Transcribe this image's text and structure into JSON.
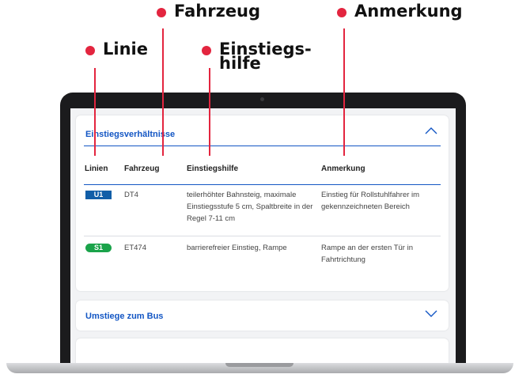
{
  "annotations": {
    "linie": "Linie",
    "fahrzeug": "Fahrzeug",
    "einstiegshilfe": "Einstiegs-\nhilfe",
    "anmerkung": "Anmerkung"
  },
  "accent_color": "#e3253f",
  "link_color": "#1356c4",
  "section_einstieg": {
    "title": "Einstiegsverhältnisse",
    "expanded": true,
    "headers": [
      "Linien",
      "Fahrzeug",
      "Einstiegshilfe",
      "Anmerkung"
    ],
    "rows": [
      {
        "line": "U1",
        "vehicle": "DT4",
        "aid": "teilerhöhter Bahnsteig, maximale Einstiegsstufe 5 cm, Spaltbreite in der Regel 7-11 cm",
        "note": "Einstieg für Rollstuhlfahrer im gekennzeichneten Bereich"
      },
      {
        "line": "S1",
        "vehicle": "ET474",
        "aid": "barrierefreier Einstieg, Rampe",
        "note": "Rampe an der ersten Tür in Fahrtrichtung"
      }
    ]
  },
  "section_bus": {
    "title": "Umstiege zum Bus",
    "expanded": false
  },
  "icons": {
    "collapse": "chevron-up-icon",
    "expand": "chevron-down-icon"
  }
}
